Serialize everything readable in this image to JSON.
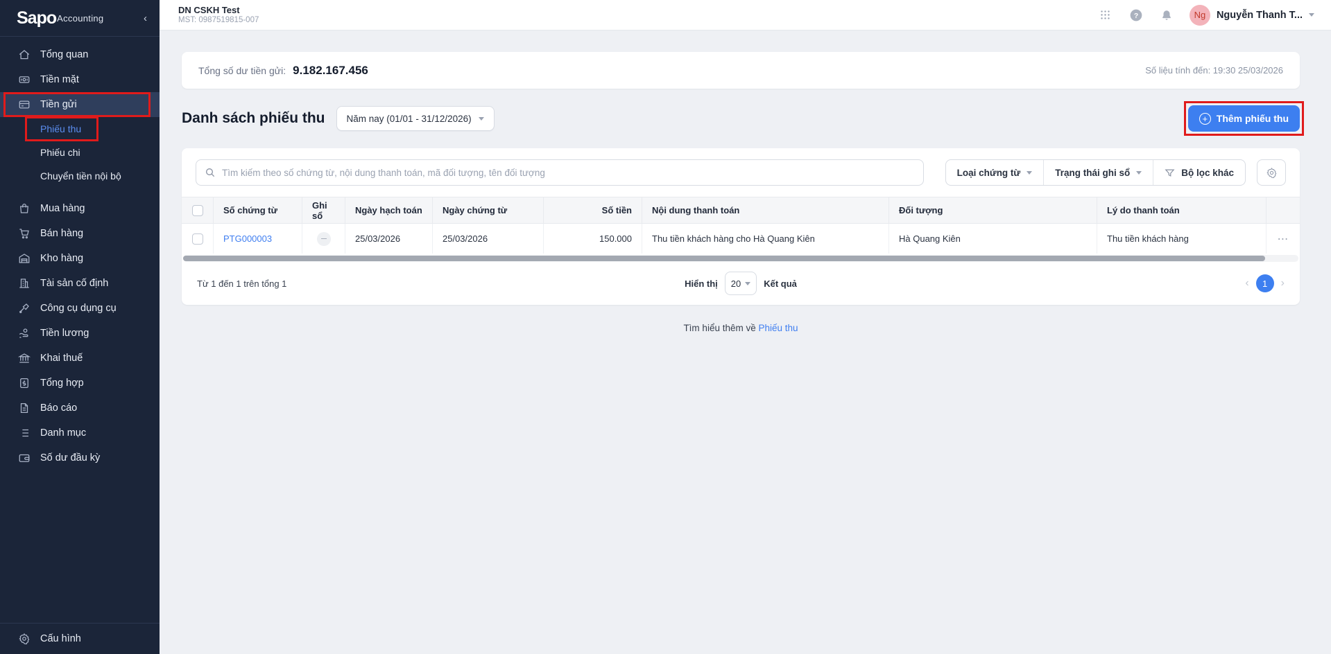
{
  "app": {
    "brand": "Sapo",
    "brand_suffix": "Accounting"
  },
  "sidebar": {
    "items": [
      {
        "label": "Tổng quan"
      },
      {
        "label": "Tiền mặt"
      },
      {
        "label": "Tiền gửi"
      },
      {
        "label": "Mua hàng"
      },
      {
        "label": "Bán hàng"
      },
      {
        "label": "Kho hàng"
      },
      {
        "label": "Tài sản cố định"
      },
      {
        "label": "Công cụ dụng cụ"
      },
      {
        "label": "Tiền lương"
      },
      {
        "label": "Khai thuế"
      },
      {
        "label": "Tổng hợp"
      },
      {
        "label": "Báo cáo"
      },
      {
        "label": "Danh mục"
      },
      {
        "label": "Số dư đầu kỳ"
      }
    ],
    "sub_items": [
      {
        "label": "Phiếu thu"
      },
      {
        "label": "Phiếu chi"
      },
      {
        "label": "Chuyển tiền nội bộ"
      }
    ],
    "footer": {
      "label": "Cấu hình"
    }
  },
  "header": {
    "company_name": "DN CSKH Test",
    "company_tax": "MST: 0987519815-007",
    "user_initials": "Ng",
    "user_name": "Nguyễn Thanh T..."
  },
  "summary": {
    "label": "Tổng số dư tiền gửi:",
    "value": "9.182.167.456",
    "as_of": "Số liệu tính đến: 19:30 25/03/2026"
  },
  "page": {
    "title": "Danh sách phiếu thu",
    "period": "Năm nay (01/01 - 31/12/2026)",
    "add_button": "Thêm phiếu thu"
  },
  "filters": {
    "search_placeholder": "Tìm kiếm theo số chứng từ, nội dung thanh toán, mã đối tượng, tên đối tượng",
    "doc_type": "Loại chứng từ",
    "record_status": "Trạng thái ghi sổ",
    "other_filters": "Bộ lọc khác"
  },
  "table": {
    "columns": [
      "Số chứng từ",
      "Ghi sổ",
      "Ngày hạch toán",
      "Ngày chứng từ",
      "Số tiền",
      "Nội dung thanh toán",
      "Đối tượng",
      "Lý do thanh toán"
    ],
    "rows": [
      {
        "code": "PTG000003",
        "posting_date": "25/03/2026",
        "doc_date": "25/03/2026",
        "amount": "150.000",
        "description": "Thu tiền khách hàng cho Hà Quang Kiên",
        "partner": "Hà Quang Kiên",
        "reason": "Thu tiền khách hàng"
      }
    ]
  },
  "pagination": {
    "summary": "Từ 1 đến 1 trên tổng 1",
    "show_label": "Hiển thị",
    "page_size": "20",
    "results_label": "Kết quả",
    "current_page": "1"
  },
  "footer_note": {
    "text": "Tìm hiểu thêm về",
    "link": "Phiếu thu"
  },
  "colors": {
    "sidebar_bg": "#1b2539",
    "sidebar_active_bg": "#2f3e5c",
    "accent_blue": "#3d7ff0",
    "link_blue": "#3f7ef0",
    "annotation_red": "#e01b1b",
    "avatar_pink": "#f3b3ba",
    "page_bg": "#eef0f4"
  }
}
